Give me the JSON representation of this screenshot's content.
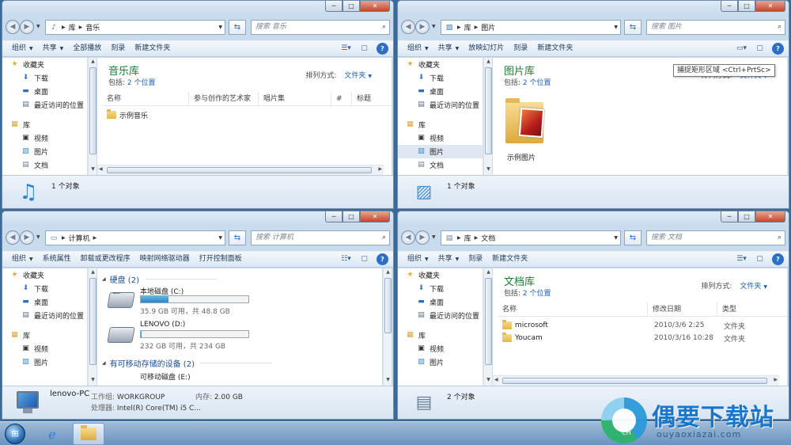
{
  "window_controls": {
    "minimize": "─",
    "maximize": "□",
    "close": "✕"
  },
  "music": {
    "path": [
      "库",
      "音乐"
    ],
    "search_placeholder": "搜索 音乐",
    "toolbar": [
      "组织",
      "共享",
      "全部播放",
      "刻录",
      "新建文件夹"
    ],
    "nav": [
      {
        "label": "收藏夹",
        "icon": "star-icon"
      },
      {
        "label": "下载",
        "icon": "download-folder-icon"
      },
      {
        "label": "桌面",
        "icon": "desktop-icon"
      },
      {
        "label": "最近访问的位置",
        "icon": "recent-places-icon"
      },
      {
        "label": "库",
        "icon": "library-icon"
      },
      {
        "label": "视频",
        "icon": "video-icon"
      },
      {
        "label": "图片",
        "icon": "pictures-icon"
      },
      {
        "label": "文档",
        "icon": "documents-icon"
      }
    ],
    "lib_title": "音乐库",
    "lib_includes": "包括:",
    "lib_locations": "2 个位置",
    "arrange_label": "排列方式:",
    "arrange_value": "文件夹",
    "columns": [
      "名称",
      "参与创作的艺术家",
      "唱片集",
      "#",
      "标题"
    ],
    "items": [
      {
        "name": "示例音乐"
      }
    ],
    "status": "1 个对象"
  },
  "pictures": {
    "path": [
      "库",
      "图片"
    ],
    "search_placeholder": "搜索 图片",
    "toolbar": [
      "组织",
      "共享",
      "放映幻灯片",
      "刻录",
      "新建文件夹"
    ],
    "nav": [
      {
        "label": "收藏夹"
      },
      {
        "label": "下载"
      },
      {
        "label": "桌面"
      },
      {
        "label": "最近访问的位置"
      },
      {
        "label": "库"
      },
      {
        "label": "视频"
      },
      {
        "label": "图片"
      },
      {
        "label": "文档"
      }
    ],
    "lib_title": "图片库",
    "lib_includes": "包括:",
    "lib_locations": "2 个位置",
    "arrange_label": "排列方式:",
    "arrange_value": "文件夹",
    "item": "示例图片",
    "tooltip": "捕捉矩形区域 <Ctrl+PrtSc>",
    "status": "1 个对象"
  },
  "computer": {
    "path": [
      "计算机"
    ],
    "search_placeholder": "搜索 计算机",
    "toolbar": [
      "组织",
      "系统属性",
      "卸载或更改程序",
      "映射网络驱动器",
      "打开控制面板"
    ],
    "nav": [
      {
        "label": "收藏夹"
      },
      {
        "label": "下载"
      },
      {
        "label": "桌面"
      },
      {
        "label": "最近访问的位置"
      },
      {
        "label": "库"
      },
      {
        "label": "视频"
      },
      {
        "label": "图片"
      }
    ],
    "group_hdd": "硬盘 (2)",
    "drives": [
      {
        "name": "本地磁盘 (C:)",
        "size": "35.9 GB 可用，共 48.8 GB",
        "used_fraction": 0.26
      },
      {
        "name": "LENOVO (D:)",
        "size": "232 GB 可用，共 234 GB",
        "used_fraction": 0.01
      }
    ],
    "group_removable": "有可移动存储的设备 (2)",
    "removable_first": "可移动磁盘 (E:)",
    "pc_name": "lenovo-PC",
    "workgroup_label": "工作组:",
    "workgroup": "WORKGROUP",
    "memory_label": "内存:",
    "memory": "2.00 GB",
    "cpu_label": "处理器:",
    "cpu": "Intel(R) Core(TM) i5 C..."
  },
  "documents": {
    "path": [
      "库",
      "文档"
    ],
    "search_placeholder": "搜索 文档",
    "toolbar": [
      "组织",
      "共享",
      "刻录",
      "新建文件夹"
    ],
    "nav": [
      {
        "label": "收藏夹"
      },
      {
        "label": "下载"
      },
      {
        "label": "桌面"
      },
      {
        "label": "最近访问的位置"
      },
      {
        "label": "库"
      },
      {
        "label": "视频"
      },
      {
        "label": "图片"
      }
    ],
    "lib_title": "文档库",
    "lib_includes": "包括:",
    "lib_locations": "2 个位置",
    "arrange_label": "排列方式:",
    "arrange_value": "文件夹",
    "columns": [
      "名称",
      "修改日期",
      "类型"
    ],
    "items": [
      {
        "name": "microsoft",
        "date": "2010/3/6 2:25",
        "type": "文件夹"
      },
      {
        "name": "Youcam",
        "date": "2010/3/16 10:28",
        "type": "文件夹"
      }
    ],
    "status": "2 个对象"
  },
  "watermark": {
    "text": "偶要下载站",
    "url": "ouyaoxiazai.com",
    "tag": "CH"
  }
}
